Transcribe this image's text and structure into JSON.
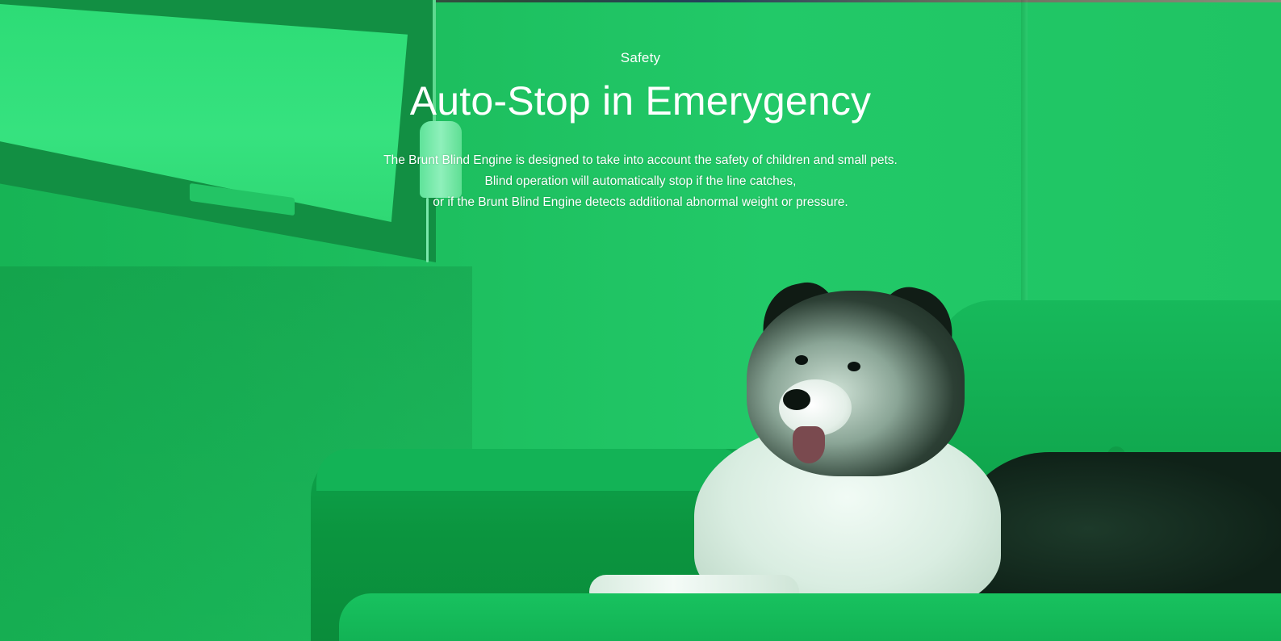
{
  "hero": {
    "eyebrow": "Safety",
    "headline": "Auto-Stop in Emerygency",
    "body_lines": [
      "The Brunt Blind Engine is designed to take into account the safety of children and small pets.",
      "Blind operation will automatically stop if the line catches,",
      "or if the Brunt Blind Engine detects additional abnormal weight or pressure."
    ]
  },
  "colors": {
    "overlay_green": "#1fbf5f",
    "text": "#ffffff"
  }
}
